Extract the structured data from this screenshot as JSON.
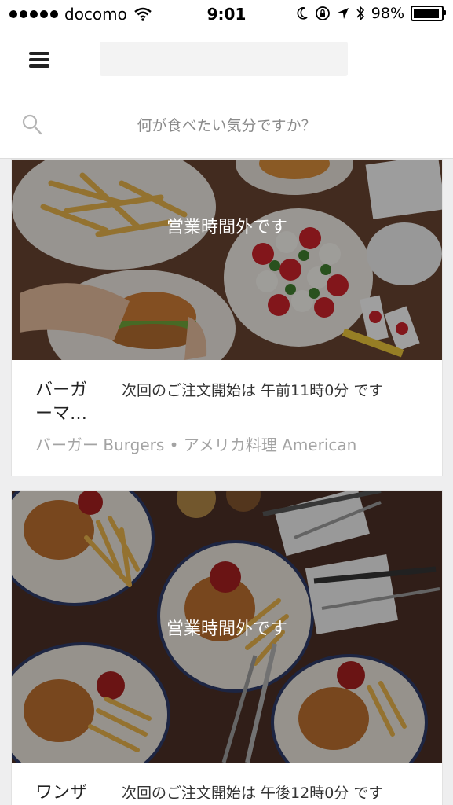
{
  "status_bar": {
    "carrier": "docomo",
    "time": "9:01",
    "battery": "98%"
  },
  "search": {
    "placeholder": "何が食べたい気分ですか？"
  },
  "restaurants": [
    {
      "name": "バーガーマ…",
      "name_line1": "バーガ",
      "name_line2": "ーマ…",
      "status": "営業時間外です",
      "next_order": "次回のご注文開始は 午前11時0分 です",
      "cuisine": "バーガー Burgers • アメリカ料理 American"
    },
    {
      "name": "ワンザ",
      "status": "営業時間外です",
      "next_order": "次回のご注文開始は 午後12時0分 です"
    }
  ]
}
